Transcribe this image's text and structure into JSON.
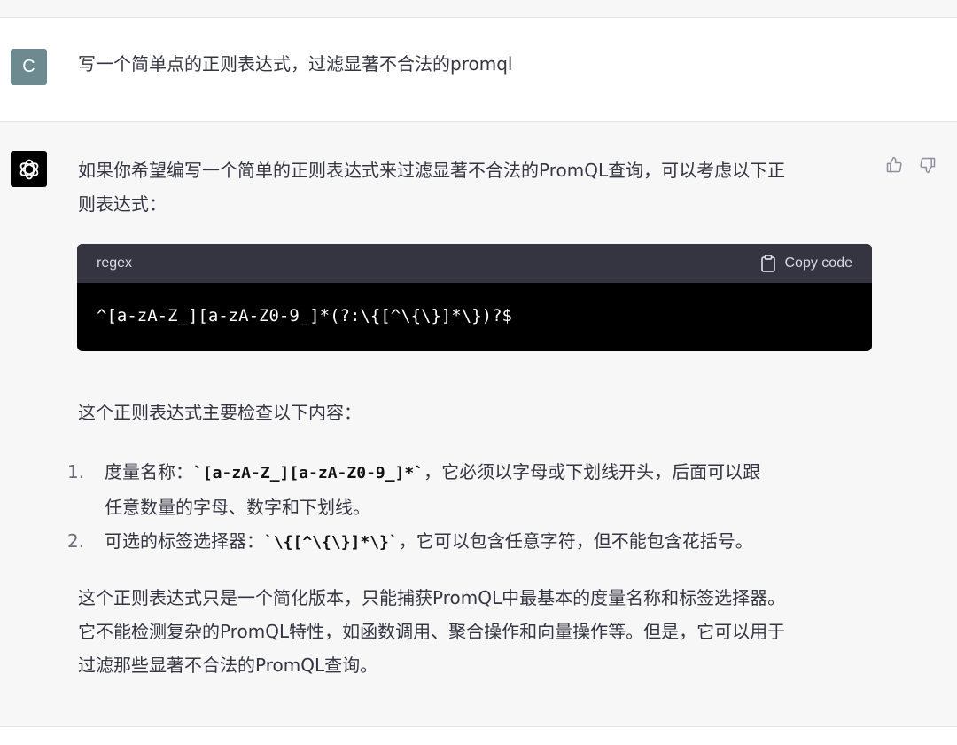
{
  "user_message": {
    "avatar_letter": "C",
    "text": "写一个简单点的正则表达式，过滤显著不合法的promql"
  },
  "assistant_message": {
    "intro_line1": "如果你希望编写一个简单的正则表达式来过滤显著不合法的PromQL查询，可以考虑以下正",
    "intro_line2": "则表达式：",
    "code_block": {
      "language": "regex",
      "copy_label": "Copy code",
      "code": "^[a-zA-Z_][a-zA-Z0-9_]*(?:\\{[^\\{\\}]*\\})?$"
    },
    "check_heading": "这个正则表达式主要检查以下内容：",
    "list_items": [
      {
        "number": "1.",
        "prefix": "度量名称：",
        "code": "`[a-zA-Z_][a-zA-Z0-9_]*`",
        "suffix_line1": "，它必须以字母或下划线开头，后面可以跟",
        "line2": "任意数量的字母、数字和下划线。"
      },
      {
        "number": "2.",
        "prefix": "可选的标签选择器：",
        "code": "`\\{[^\\{\\}]*\\}`",
        "suffix_line1": "，它可以包含任意字符，但不能包含花括号。"
      }
    ],
    "closing_line1": "这个正则表达式只是一个简化版本，只能捕获PromQL中最基本的度量名称和标签选择器。",
    "closing_line2": "它不能检测复杂的PromQL特性，如函数调用、聚合操作和向量操作等。但是，它可以用于",
    "closing_line3": "过滤那些显著不合法的PromQL查询。"
  },
  "icons": {
    "bot_avatar": "openai-logo-icon",
    "thumbs_up": "thumbs-up-icon",
    "thumbs_down": "thumbs-down-icon",
    "copy": "clipboard-icon"
  },
  "colors": {
    "user_avatar_bg": "#6e8a91",
    "bot_avatar_bg": "#000000",
    "code_header_bg": "#343541",
    "code_body_bg": "#000000",
    "assistant_bg": "#f7f7f8"
  }
}
